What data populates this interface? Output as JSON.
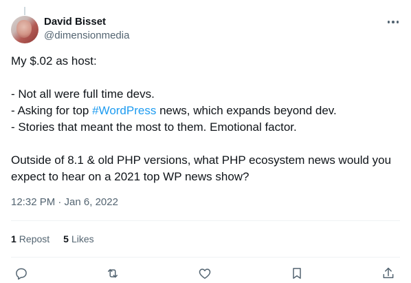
{
  "tweet": {
    "author_name": "David Bisset",
    "author_handle": "@dimensionmedia",
    "text_before_hashtag": "My $.02 as host:\n\n- Not all were full time devs.\n- Asking for top ",
    "hashtag": "#WordPress",
    "text_after_hashtag": " news, which expands beyond dev.\n- Stories that meant the most to them. Emotional factor.\n\nOutside of 8.1 & old PHP versions, what PHP ecosystem news would you expect to hear on a 2021 top WP news show?",
    "timestamp": "12:32 PM · Jan 6, 2022"
  },
  "stats": {
    "reposts_count": "1",
    "reposts_label": "Repost",
    "likes_count": "5",
    "likes_label": "Likes"
  },
  "icons": {
    "more": "more-horizontal-icon",
    "reply": "reply-icon",
    "repost": "repost-icon",
    "like": "heart-icon",
    "bookmark": "bookmark-icon",
    "share": "share-icon"
  },
  "colors": {
    "text": "#0f1419",
    "secondary": "#536471",
    "accent": "#1d9bf0",
    "divider": "#eff3f4"
  }
}
